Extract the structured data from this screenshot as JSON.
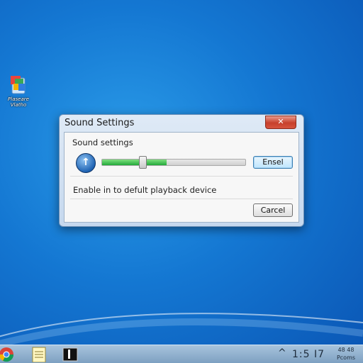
{
  "desktop": {
    "icon_label": "Plaseare\nVlatho",
    "icon_name": "recycle-bin-icon"
  },
  "window": {
    "title": "Sound Settings",
    "close_symbol": "✕",
    "section_label": "Sound settings",
    "volume_icon_glyph": "↑",
    "volume_level": 0.45,
    "primary_button": "Ensel",
    "description": "Enable in to defult playback device",
    "cancel_button": "Carcel"
  },
  "taskbar": {
    "apps": [
      "chrome-icon",
      "notepad-icon",
      "terminal-icon"
    ],
    "chevron": "^",
    "clock": "1:5 I7",
    "date_line1": "48 48",
    "date_line2": "Pcoms"
  },
  "colors": {
    "desktop_accent": "#1477d2",
    "close_red": "#c7402c",
    "volume_green": "#22a93a"
  }
}
